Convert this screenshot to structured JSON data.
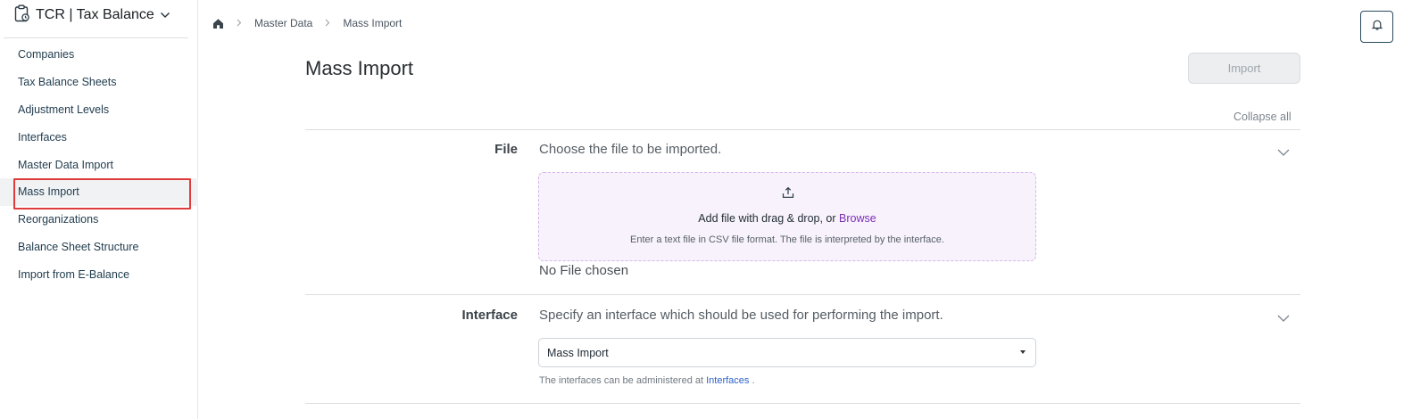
{
  "app": {
    "title": "TCR | Tax Balance"
  },
  "sidebar": {
    "items": [
      {
        "label": "Companies"
      },
      {
        "label": "Tax Balance Sheets"
      },
      {
        "label": "Adjustment Levels"
      },
      {
        "label": "Interfaces"
      },
      {
        "label": "Master Data Import"
      },
      {
        "label": "Mass Import",
        "active": true
      },
      {
        "label": "Reorganizations"
      },
      {
        "label": "Balance Sheet Structure"
      },
      {
        "label": "Import from E-Balance"
      }
    ]
  },
  "breadcrumb": {
    "items": [
      "Master Data",
      "Mass Import"
    ]
  },
  "page": {
    "title": "Mass Import",
    "import_label": "Import",
    "collapse_all": "Collapse all"
  },
  "file_section": {
    "label": "File",
    "description": "Choose the file to be imported.",
    "drop_text": "Add file with drag & drop, or",
    "browse_label": "Browse",
    "hint": "Enter a text file in CSV file format. The file is interpreted by the interface.",
    "status": "No File chosen"
  },
  "interface_section": {
    "label": "Interface",
    "description": "Specify an interface which should be used for performing the import.",
    "selected_value": "Mass Import",
    "help_prefix": "The interfaces can be administered at",
    "help_link": "Interfaces",
    "help_suffix": "."
  },
  "colors": {
    "accent": "#7b2fb6",
    "link": "#2d62c7",
    "highlight": "#e03b3b"
  }
}
